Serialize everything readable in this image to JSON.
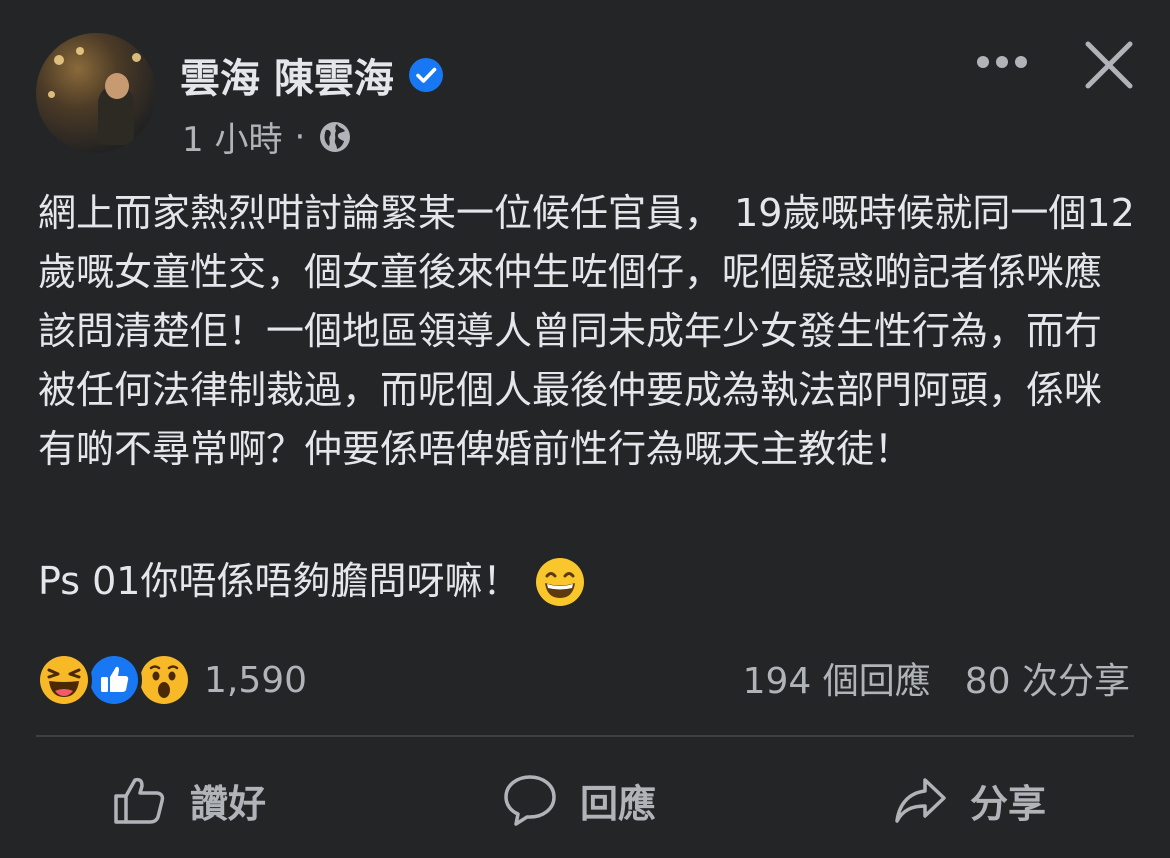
{
  "post": {
    "author": "雲海 陳雲海",
    "time": "1 小時",
    "separator": "·",
    "body": "網上而家熱烈咁討論緊某一位候任官員， 19歲嘅時候就同一個12歲嘅女童性交，個女童後來仲生咗個仔，呢個疑惑啲記者係咪應該問清楚佢！一個地區領導人曾同未成年少女發生性行為，而冇被任何法律制裁過，而呢個人最後仲要成為執法部門阿頭，係咪有啲不尋常啊？仲要係唔俾婚前性行為嘅天主教徒！",
    "ps": "Ps 01你唔係唔夠膽問呀嘛！"
  },
  "reactions": {
    "count": "1,590",
    "types": [
      "haha-emoji-icon",
      "like-icon",
      "wow-emoji-icon"
    ]
  },
  "stats": {
    "comments": "194 個回應",
    "shares": "80 次分享"
  },
  "actions": {
    "like": "讚好",
    "comment": "回應",
    "share": "分享"
  },
  "colors": {
    "background": "#242526",
    "text_primary": "#e4e6eb",
    "text_secondary": "#b0b3b8",
    "verified": "#1877f2",
    "divider": "#3e4042"
  }
}
